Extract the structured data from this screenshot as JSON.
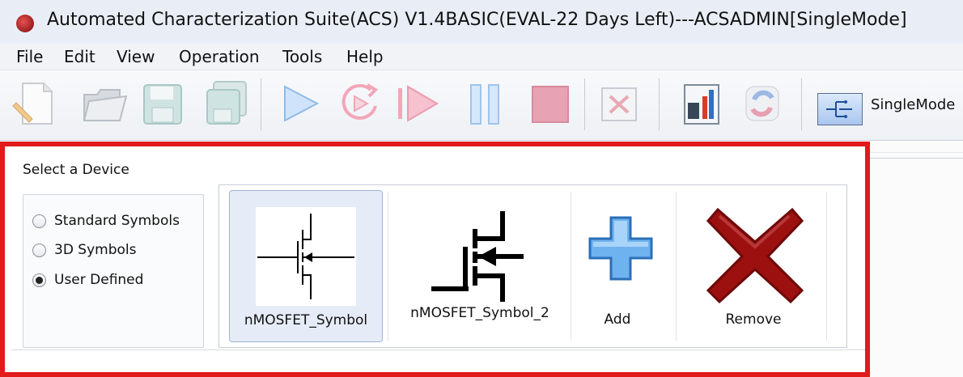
{
  "window": {
    "title": "Automated Characterization Suite(ACS) V1.4BASIC(EVAL-22 Days Left)---ACSADMIN[SingleMode]"
  },
  "menu": [
    "File",
    "Edit",
    "View",
    "Operation",
    "Tools",
    "Help"
  ],
  "toolbar": {
    "mode_label": "SingleMode",
    "buttons": [
      "new-icon",
      "open-icon",
      "save-icon",
      "save-all-icon",
      "run-icon",
      "repeat-run-icon",
      "step-run-icon",
      "pause-icon",
      "stop-icon",
      "cancel-icon",
      "tool-settings-icon",
      "refresh-icon",
      "mode-icon"
    ]
  },
  "device_selector": {
    "title": "Select a Device",
    "options": [
      {
        "label": "Standard Symbols",
        "selected": false
      },
      {
        "label": "3D Symbols",
        "selected": false
      },
      {
        "label": "User Defined",
        "selected": true
      }
    ],
    "devices": [
      {
        "label": "nMOSFET_Symbol",
        "selected": true,
        "icon": "nmosfet-symbol-icon"
      },
      {
        "label": "nMOSFET_Symbol_2",
        "selected": false,
        "icon": "nmosfet-symbol-2-icon"
      },
      {
        "label": "Add",
        "selected": false,
        "icon": "add-icon"
      },
      {
        "label": "Remove",
        "selected": false,
        "icon": "remove-icon"
      }
    ]
  },
  "colors": {
    "highlight_outline": "#e11a1a",
    "selected_tile": "#e6ecf7"
  }
}
